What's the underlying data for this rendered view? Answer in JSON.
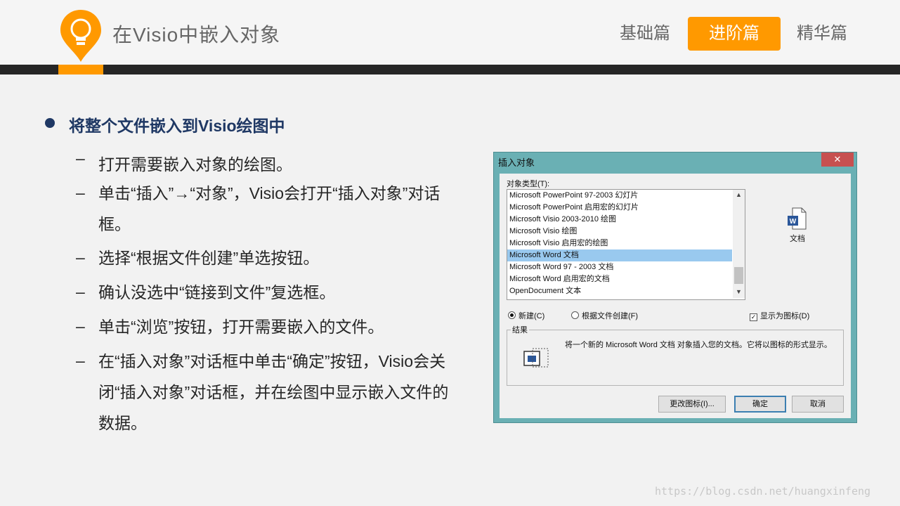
{
  "header": {
    "title": "在Visio中嵌入对象",
    "nav": [
      "基础篇",
      "进阶篇",
      "精华篇"
    ],
    "active_nav": "进阶篇",
    "accent_color": "#ff9900",
    "bar_color": "#262626",
    "logo_icon": "lightbulb-icon"
  },
  "content": {
    "bullet": "将整个文件嵌入到Visio绘图中",
    "dash": "–",
    "steps": [
      "打开需要嵌入对象的绘图。",
      "单击“插入”→“对象”，Visio会打开“插入对象”对话框。",
      "选择“根据文件创建”单选按钮。",
      "确认没选中“链接到文件”复选框。",
      "单击“浏览”按钮，打开需要嵌入的文件。",
      "在“插入对象”对话框中单击“确定”按钮，Visio会关闭“插入对象”对话框，并在绘图中显示嵌入文件的数据。"
    ]
  },
  "dialog": {
    "title": "插入对象",
    "close": "✕",
    "type_label": "对象类型(T):",
    "list_items": [
      "Microsoft PowerPoint 97-2003 幻灯片",
      "Microsoft PowerPoint 启用宏的幻灯片",
      "Microsoft Visio 2003-2010 绘图",
      "Microsoft Visio 绘图",
      "Microsoft Visio 启用宏的绘图",
      "Microsoft Word 文档",
      "Microsoft Word 97 - 2003 文档",
      "Microsoft Word 启用宏的文档",
      "OpenDocument 文本"
    ],
    "selected_item": "Microsoft Word 文档",
    "icon_label": "文档",
    "radio_new": "新建(C)",
    "radio_file": "根据文件创建(F)",
    "checkbox_icon": "显示为图标(D)",
    "checkbox_checked": true,
    "result_label": "结果",
    "result_text": "将一个新的 Microsoft Word 文档 对象插入您的文档。它将以图标的形式显示。",
    "btn_change_icon": "更改图标(I)...",
    "btn_ok": "确定",
    "btn_cancel": "取消"
  },
  "watermark": "https://blog.csdn.net/huangxinfeng"
}
